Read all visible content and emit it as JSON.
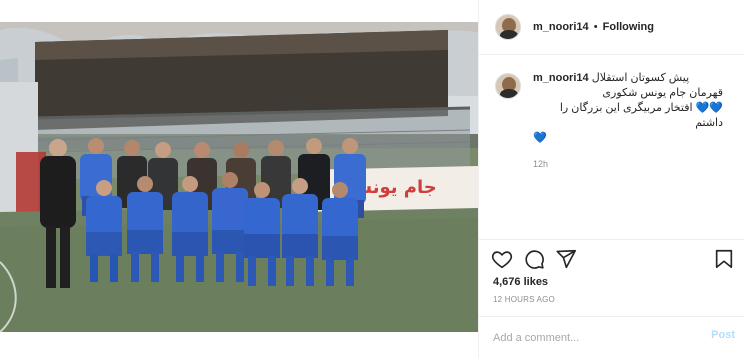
{
  "post": {
    "username": "m_noori14",
    "header_separator": "•",
    "follow_status": "Following",
    "caption": {
      "line1": "پیش کسوتان استقلال",
      "line2": "قهرمان جام یونس شکوری",
      "line3": "افتخار مربیگری این بزرگان را داشتم",
      "hearts": "💙💙"
    },
    "comment_time": "12h",
    "likes": "4,676 likes",
    "age": "12 HOURS AGO",
    "add_comment_placeholder": "Add a comment...",
    "post_button": "Post"
  },
  "media": {
    "banner_text": "جام یونس",
    "carousel": {
      "count": 2,
      "active": 1
    }
  },
  "icons": {
    "like": "heart-icon",
    "comment": "comment-icon",
    "share": "share-icon",
    "save": "bookmark-icon"
  },
  "colors": {
    "accent": "#0095f6",
    "post_button": "#b2dffc",
    "muted": "#8e8e8e",
    "jersey": "#2f63c9"
  }
}
